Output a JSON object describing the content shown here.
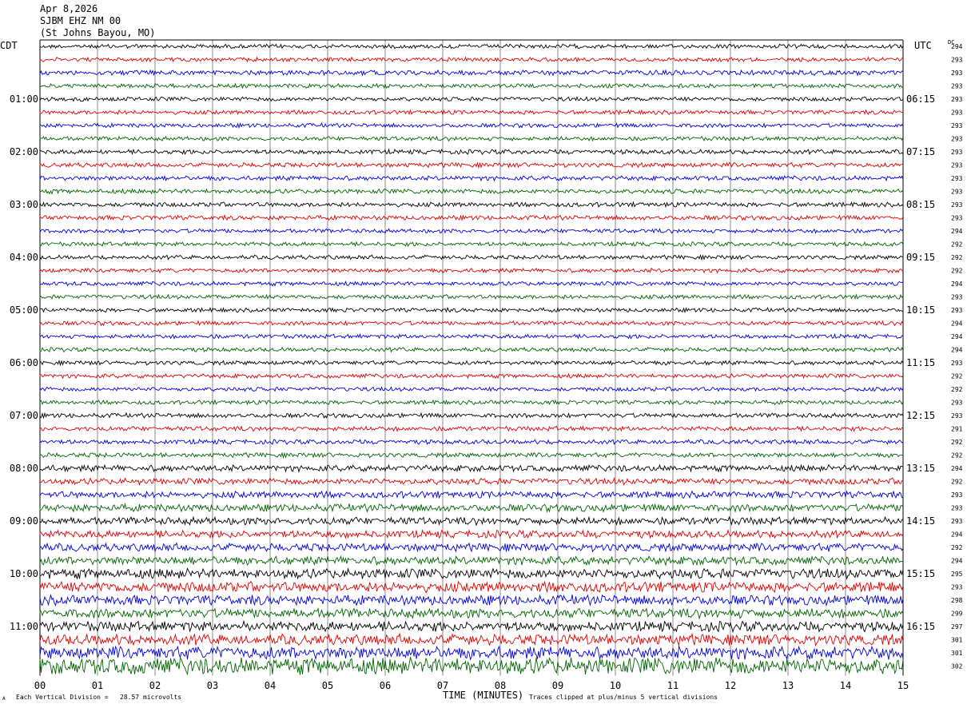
{
  "header": {
    "date": "Apr 8,2026",
    "station": "SJBM EHZ NM 00",
    "location": "(St Johns Bayou, MO)"
  },
  "left_tz": "CDT",
  "right_tz": "UTC",
  "dc_label": "DC",
  "footer": {
    "scale_note": "Each Vertical Division =   28.57 microvolts",
    "clip_note": "Traces clipped at plus/minus 5 vertical divisions",
    "corner_mark": "A"
  },
  "colors": {
    "black": "#000000",
    "red": "#e00000",
    "blue": "#0000e0",
    "green": "#006400",
    "grid": "#888888"
  },
  "chart_data": {
    "type": "line",
    "title": "",
    "xlabel": "TIME (MINUTES)",
    "ylabel": "",
    "xlim": [
      0,
      15
    ],
    "x_ticks": [
      "00",
      "01",
      "02",
      "03",
      "04",
      "05",
      "06",
      "07",
      "08",
      "09",
      "10",
      "11",
      "12",
      "13",
      "14",
      "15"
    ],
    "trace_color_cycle": [
      "black",
      "red",
      "blue",
      "green"
    ],
    "left_hour_labels": [
      {
        "row": 4,
        "label": "01:00"
      },
      {
        "row": 8,
        "label": "02:00"
      },
      {
        "row": 12,
        "label": "03:00"
      },
      {
        "row": 16,
        "label": "04:00"
      },
      {
        "row": 20,
        "label": "05:00"
      },
      {
        "row": 24,
        "label": "06:00"
      },
      {
        "row": 28,
        "label": "07:00"
      },
      {
        "row": 32,
        "label": "08:00"
      },
      {
        "row": 36,
        "label": "09:00"
      },
      {
        "row": 40,
        "label": "10:00"
      },
      {
        "row": 44,
        "label": "11:00"
      }
    ],
    "right_hour_labels": [
      {
        "row": 4,
        "label": "06:15"
      },
      {
        "row": 8,
        "label": "07:15"
      },
      {
        "row": 12,
        "label": "08:15"
      },
      {
        "row": 16,
        "label": "09:15"
      },
      {
        "row": 20,
        "label": "10:15"
      },
      {
        "row": 24,
        "label": "11:15"
      },
      {
        "row": 28,
        "label": "12:15"
      },
      {
        "row": 32,
        "label": "13:15"
      },
      {
        "row": 36,
        "label": "14:15"
      },
      {
        "row": 40,
        "label": "15:15"
      },
      {
        "row": 44,
        "label": "16:15"
      }
    ],
    "dc_offsets": [
      "294",
      "293",
      "293",
      "293",
      "293",
      "293",
      "293",
      "293",
      "293",
      "293",
      "293",
      "293",
      "293",
      "293",
      "294",
      "292",
      "292",
      "292",
      "294",
      "293",
      "293",
      "294",
      "294",
      "294",
      "293",
      "292",
      "292",
      "293",
      "293",
      "291",
      "292",
      "292",
      "294",
      "292",
      "293",
      "293",
      "293",
      "294",
      "292",
      "294",
      "295",
      "293",
      "298",
      "299",
      "297",
      "301",
      "301",
      "302"
    ],
    "trace_amplitude_levels": [
      1,
      1,
      1.2,
      1,
      1,
      1,
      1,
      1,
      1.1,
      1.1,
      1.1,
      1.1,
      1.1,
      1.1,
      1,
      1,
      1,
      1,
      1,
      1,
      1,
      1,
      1,
      1,
      1,
      1,
      1,
      1,
      1.1,
      1.1,
      1.1,
      1.1,
      1.5,
      1.5,
      1.6,
      1.8,
      1.8,
      1.8,
      1.9,
      2,
      2.4,
      2.5,
      2.4,
      2.3,
      2.4,
      2.6,
      3,
      4
    ]
  }
}
